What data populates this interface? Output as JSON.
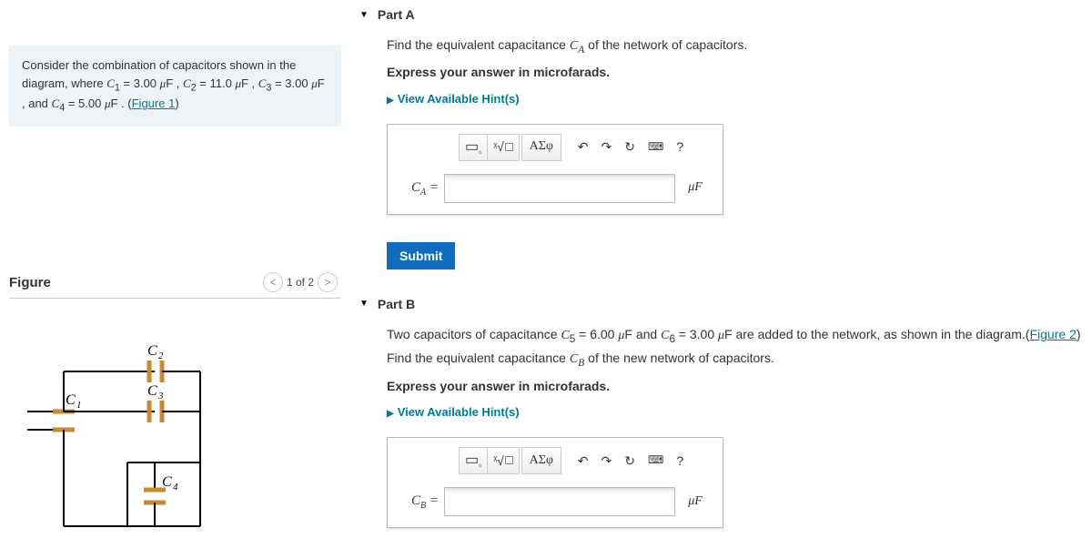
{
  "intro": {
    "full": "Consider the combination of capacitors shown in the diagram, where C₁ = 3.00 μF , C₂ = 11.0 μF , C₃ = 3.00 μF , and C₄ = 5.00 μF . (Figure 1)",
    "figure_link": "Figure 1"
  },
  "figure": {
    "title": "Figure",
    "pager": "1 of 2",
    "labels": {
      "c1": "C₁",
      "c2": "C₂",
      "c3": "C₃",
      "c4": "C₄"
    }
  },
  "partA": {
    "title": "Part A",
    "prompt_html": "Find the equivalent capacitance Cᴀ of the network of capacitors.",
    "instr": "Express your answer in microfarads.",
    "hints": "View Available Hint(s)",
    "label": "Cᴀ =",
    "unit": "μF",
    "value": "",
    "submit": "Submit"
  },
  "partB": {
    "title": "Part B",
    "prompt": "Two capacitors of capacitance C₅ = 6.00 μF and C₆ = 3.00 μF are added to the network, as shown in the diagram.(Figure 2) Find the equivalent capacitance Cʙ of the new network of capacitors.",
    "figure_link": "Figure 2",
    "instr": "Express your answer in microfarads.",
    "hints": "View Available Hint(s)",
    "label": "Cʙ =",
    "unit": "μF",
    "value": ""
  },
  "toolbar": {
    "template": "▭",
    "sqrt": "ᵡ√☐",
    "greek": "ΑΣφ",
    "undo": "↶",
    "redo": "↷",
    "reset": "↻",
    "keyboard": "⌨",
    "help": "?"
  }
}
